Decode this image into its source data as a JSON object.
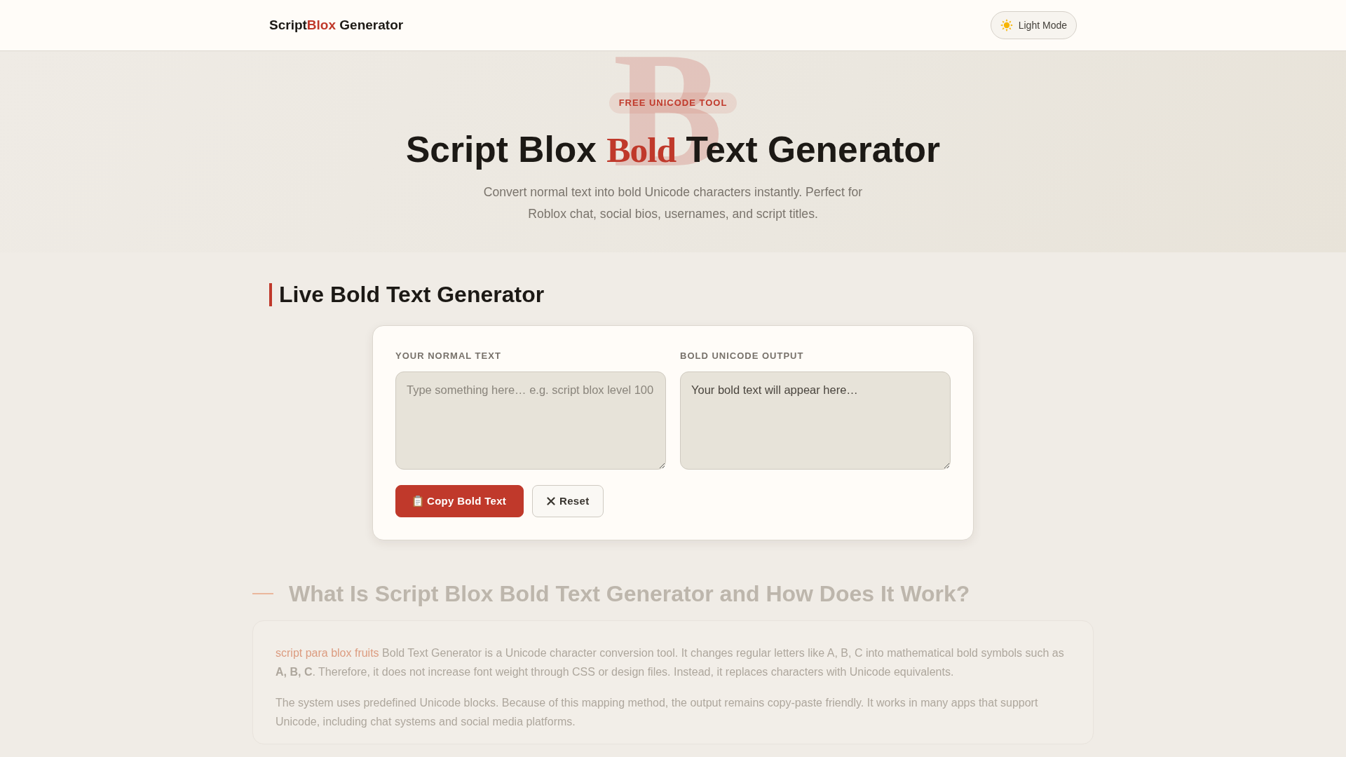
{
  "header": {
    "logo": {
      "brand": [
        {
          "text": "Script",
          "accent": false
        },
        {
          "text": "Blox",
          "accent": true
        }
      ],
      "suffix": "Generator"
    },
    "theme_toggle": {
      "label": "Light Mode"
    }
  },
  "hero": {
    "backdrop_letter": "B",
    "badge": "FREE UNICODE TOOL",
    "title": [
      {
        "text": "Script Blox",
        "highlight": false
      },
      {
        "text": "Bold",
        "highlight": true
      },
      {
        "text": "Text Generator",
        "highlight": false
      }
    ],
    "subtitle": "Convert normal text into bold Unicode characters instantly. Perfect for Roblox chat, social bios, usernames, and script titles."
  },
  "generator": {
    "heading": "Live Bold Text Generator",
    "input": {
      "label": "YOUR NORMAL TEXT",
      "placeholder": "Type something here… e.g. script blox level 100"
    },
    "output": {
      "label": "BOLD UNICODE OUTPUT",
      "value": "Your bold text will appear here…"
    },
    "buttons": [
      {
        "label": "Copy Bold Text",
        "kind": "primary"
      },
      {
        "label": "Reset",
        "kind": "secondary"
      }
    ]
  },
  "about": {
    "heading": "What Is Script Blox Bold Text Generator and How Does It Work?",
    "paragraphs": [
      {
        "link": "script para blox fruits",
        "text": "Bold Text Generator is a Unicode character conversion tool. It changes regular letters like A, B, C into mathematical bold symbols such as **A, B, C**. Therefore, it does not increase font weight through CSS or design files. Instead, it replaces characters with Unicode equivalents."
      },
      {
        "text": "The system uses predefined Unicode blocks. Because of this mapping method, the output remains copy-paste friendly. It works in many apps that support Unicode, including chat systems and social media platforms."
      }
    ]
  }
}
